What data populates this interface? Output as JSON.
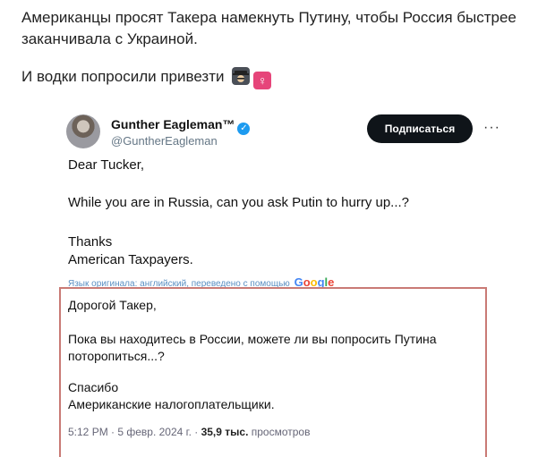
{
  "post": {
    "line1": "Американцы просят Такера намекнуть Путину, чтобы Россия быстрее заканчивала с Украиной.",
    "line2": "И водки попросили привезти",
    "emoji_female": "♀"
  },
  "tweet": {
    "author_name": "Gunther Eagleman™",
    "verified_mark": "✓",
    "handle": "@GuntherEagleman",
    "subscribe_label": "Подписаться",
    "more_label": "···",
    "body": {
      "greeting": "Dear Tucker,",
      "question": "While you are in Russia, can you ask Putin to hurry up...?",
      "thanks": "Thanks",
      "signature": "American Taxpayers."
    },
    "translate_note": "Язык оригинала: английский, переведено с помощью",
    "google": [
      "G",
      "o",
      "o",
      "g",
      "l",
      "e"
    ],
    "translation": {
      "greeting": "Дорогой Такер,",
      "question_line1": "Пока вы находитесь в России, можете ли вы попросить Путина",
      "question_line2": "поторопиться...?",
      "thanks": "Спасибо",
      "signature": "Американские налогоплательщики."
    },
    "meta": {
      "time_date": "5:12 PM · 5 февр. 2024 г. · ",
      "views_count": "35,9 тыс.",
      "views_label": " просмотров"
    }
  },
  "colors": {
    "verified": "#1d9bf0",
    "subscribe_bg": "#0f1419",
    "translation_border": "#c97a75",
    "note_link": "#5a8fc2"
  }
}
